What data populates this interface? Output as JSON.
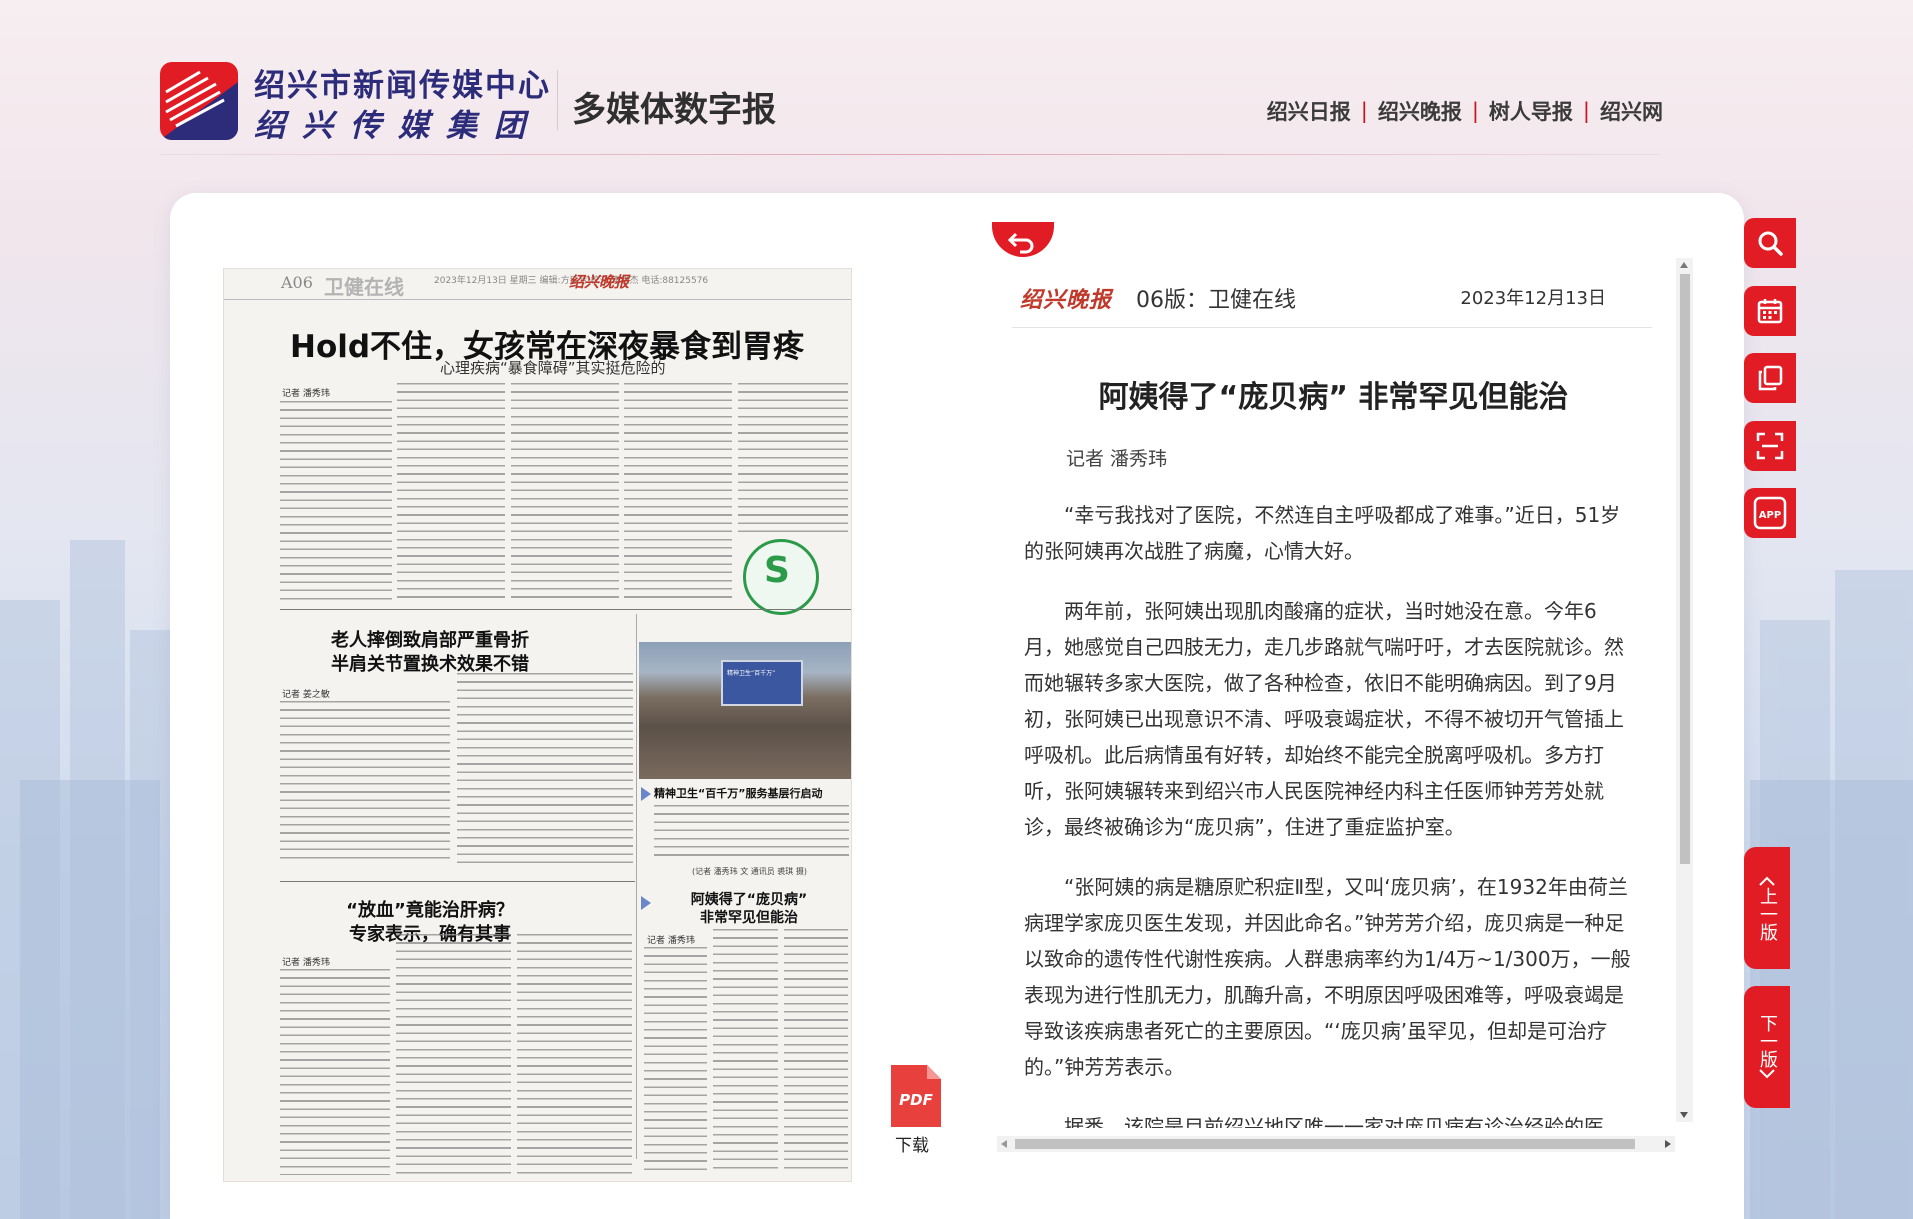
{
  "header": {
    "org_name": "绍兴市新闻传媒中心",
    "group_name": "绍兴传媒集团",
    "app_title": "多媒体数字报",
    "nav": [
      "绍兴日报",
      "绍兴晚报",
      "树人导报",
      "绍兴网"
    ]
  },
  "newspaper": {
    "page_num": "A06",
    "section": "卫健在线",
    "meta": "2023年12月13日  星期三  编辑:方延芳 校对:李雄杰 电话:88125576",
    "brand": "绍兴晚报",
    "headline": "Hold不住，女孩常在深夜暴食到胃疼",
    "subheadline": "心理疾病“暴食障碍”其实挺危险的",
    "byline1": "记者  潘秀玮",
    "story2_title_line1": "老人摔倒致肩部严重骨折",
    "story2_title_line2": "半肩关节置换术效果不错",
    "byline2": "记者  姜之敏",
    "story3_title_line1": "“放血”竟能治肝病？",
    "story3_title_line2": "专家表示，确有其事",
    "byline3": "记者  潘秀玮",
    "photo_caption_title": "精神卫生“百千万”服务基层行启动",
    "photo_credit": "(记者  潘秀玮  文  通讯员  裘琪  摄)",
    "story4_title_line1": "阿姨得了“庞贝病”",
    "story4_title_line2": "非常罕见但能治",
    "byline4": "记者  潘秀玮"
  },
  "download": {
    "icon_text": "PDF",
    "label": "下载"
  },
  "article": {
    "brand": "绍兴晚报",
    "edition": "06版：卫健在线",
    "date": "2023年12月13日",
    "title": "阿姨得了“庞贝病” 非常罕见但能治",
    "author": "记者 潘秀玮",
    "paragraphs": [
      "“幸亏我找对了医院，不然连自主呼吸都成了难事。”近日，51岁的张阿姨再次战胜了病魔，心情大好。",
      "两年前，张阿姨出现肌肉酸痛的症状，当时她没在意。今年6月，她感觉自己四肢无力，走几步路就气喘吁吁，才去医院就诊。然而她辗转多家大医院，做了各种检查，依旧不能明确病因。到了9月初，张阿姨已出现意识不清、呼吸衰竭症状，不得不被切开气管插上呼吸机。此后病情虽有好转，却始终不能完全脱离呼吸机。多方打听，张阿姨辗转来到绍兴市人民医院神经内科主任医师钟芳芳处就诊，最终被确诊为“庞贝病”，住进了重症监护室。",
      "“张阿姨的病是糖原贮积症Ⅱ型，又叫‘庞贝病’，在1932年由荷兰病理学家庞贝医生发现，并因此命名。”钟芳芳介绍，庞贝病是一种足以致命的遗传性代谢性疾病。人群患病率约为1/4万~1/300万，一般表现为进行性肌无力，肌酶升高，不明原因呼吸困难等，呼吸衰竭是导致该疾病患者死亡的主要原因。“‘庞贝病’虽罕见，但却是可治疗的。”钟芳芳表示。",
      "据悉，该院是目前绍兴地区唯一一家对庞贝病有诊治经验的医"
    ]
  },
  "tools": {
    "items": [
      "search-icon",
      "calendar-icon",
      "copy-icon",
      "scan-icon",
      "app-icon"
    ],
    "app_label": "APP",
    "prev_page": "上一版",
    "next_page": "下一版"
  },
  "colors": {
    "accent": "#e11c25",
    "brand_blue": "#2c2c7a"
  }
}
